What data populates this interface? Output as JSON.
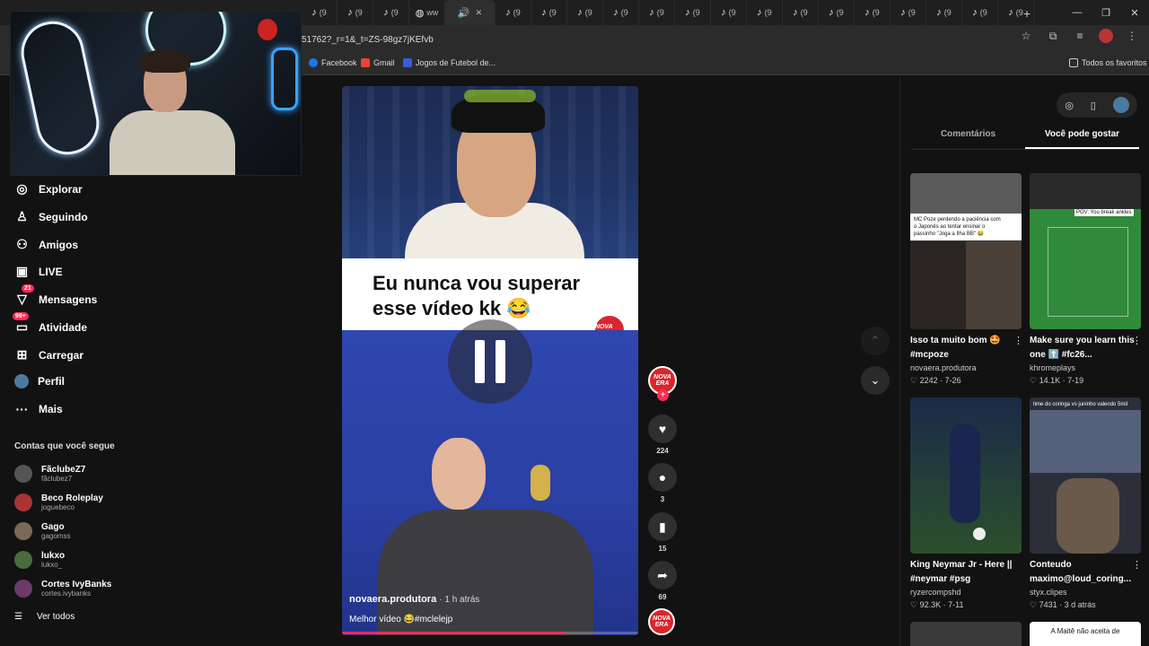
{
  "browser": {
    "tabs": [
      {
        "icon": "tiktok-icon",
        "label": "(9"
      },
      {
        "icon": "tiktok-icon",
        "label": "(9"
      },
      {
        "icon": "tiktok-icon",
        "label": "(9"
      },
      {
        "icon": "globe-icon",
        "label": "ww"
      },
      {
        "icon": "speaker-icon",
        "label": ""
      },
      {
        "icon": "tiktok-icon",
        "label": "(9"
      },
      {
        "icon": "tiktok-icon",
        "label": "(9"
      },
      {
        "icon": "tiktok-icon",
        "label": "(9"
      },
      {
        "icon": "tiktok-icon",
        "label": "(9"
      },
      {
        "icon": "tiktok-icon",
        "label": "(9"
      },
      {
        "icon": "tiktok-icon",
        "label": "(9"
      },
      {
        "icon": "tiktok-icon",
        "label": "(9"
      },
      {
        "icon": "tiktok-icon",
        "label": "(9"
      },
      {
        "icon": "tiktok-icon",
        "label": "(9"
      },
      {
        "icon": "tiktok-icon",
        "label": "(9"
      },
      {
        "icon": "tiktok-icon",
        "label": "(9"
      },
      {
        "icon": "tiktok-icon",
        "label": "(9"
      },
      {
        "icon": "tiktok-icon",
        "label": "(9"
      },
      {
        "icon": "tiktok-icon",
        "label": "(9"
      },
      {
        "icon": "tiktok-icon",
        "label": "(9"
      }
    ],
    "url": "51762?_r=1&_t=ZS-98gz7jKEfvb",
    "bookmarks": [
      {
        "label": "Facebook",
        "color": "#1877f2"
      },
      {
        "label": "Gmail",
        "color": "#ea4335"
      },
      {
        "label": "Jogos de Futebol de...",
        "color": "#3b5bdb"
      }
    ],
    "all_bookmarks": "Todos os favoritos"
  },
  "nav": {
    "items": [
      {
        "label": "Explorar",
        "icon": "compass-icon"
      },
      {
        "label": "Seguindo",
        "icon": "following-icon"
      },
      {
        "label": "Amigos",
        "icon": "friends-icon"
      },
      {
        "label": "LIVE",
        "icon": "live-icon"
      },
      {
        "label": "Mensagens",
        "icon": "messages-icon",
        "badge": "21"
      },
      {
        "label": "Atividade",
        "icon": "activity-icon",
        "badge": "99+"
      },
      {
        "label": "Carregar",
        "icon": "upload-icon"
      },
      {
        "label": "Perfil",
        "icon": "profile-icon"
      },
      {
        "label": "Mais",
        "icon": "more-icon"
      }
    ],
    "following_title": "Contas que você segue",
    "accounts": [
      {
        "name": "FãclubeZ7",
        "handle": "fãclubez7",
        "color": "#555"
      },
      {
        "name": "Beco Roleplay",
        "handle": "joguebeco",
        "color": "#a33"
      },
      {
        "name": "Gago",
        "handle": "gagomss",
        "color": "#7a6a55"
      },
      {
        "name": "lukxo",
        "handle": "lukxo_",
        "color": "#4a6b3a"
      },
      {
        "name": "Cortes IvyBanks",
        "handle": "cortes.ivybanks",
        "color": "#6b3a6b"
      }
    ],
    "see_all": "Ver todos"
  },
  "video": {
    "caption": "Eu nunca vou superar esse vídeo kk 😂",
    "brand": "NOVA ERA",
    "author": "novaera.produtora",
    "time": "· 1 h atrás",
    "description": "Melhor vídeo 😂#mclelejp",
    "progress": 0.75
  },
  "actions": {
    "likes": "224",
    "comments": "3",
    "saves": "15",
    "shares": "69"
  },
  "right_panel": {
    "tabs": [
      "Comentários",
      "Você pode gostar"
    ],
    "active_tab": 1,
    "cards": [
      {
        "title": "Isso ta muito bom 🤩 #mcpoze",
        "user": "novaera.produtora",
        "likes": "2242",
        "date": "7-26",
        "overlay": "MC Poze perdendo a paciência com o Japonês ao tentar ensinar o passinho \"Joga a Ilha BB\" 😂"
      },
      {
        "title": "Make sure you learn this one ⬆️ #fc26...",
        "user": "khromeplays",
        "likes": "14.1K",
        "date": "7-19",
        "overlay": "POV: You break ankles"
      },
      {
        "title": "King Neymar Jr - Here || #neymar #psg",
        "user": "ryzercompshd",
        "likes": "92.3K",
        "date": "7-11",
        "overlay": ""
      },
      {
        "title": "Conteudo maximo@loud_coring...",
        "user": "styx.clipes",
        "likes": "7431",
        "date": "3 d atrás",
        "overlay": "time do coringa vs juninho valendo 5mil"
      }
    ],
    "peek_text": "A Maitê não aceita de"
  }
}
